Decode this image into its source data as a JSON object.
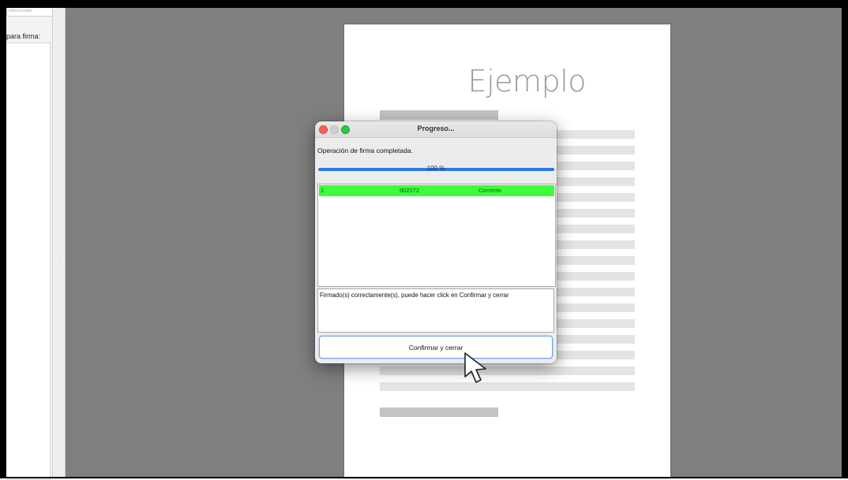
{
  "left_panel": {
    "search_placeholder": "seleccionado",
    "label": "para firma:"
  },
  "document": {
    "title": "Ejemplo"
  },
  "dialog": {
    "title": "Progreso...",
    "status": "Operación de firma completada.",
    "progress_text": "100 %",
    "progress_value": 1.0,
    "results": [
      {
        "index": "1",
        "id": "902272",
        "status": "Correcto"
      }
    ],
    "message": "Firmado(s) correctamente(s), puede hacer click en Confirmar y cerrar",
    "confirm_label": "Confirmar y cerrar"
  },
  "colors": {
    "success_row": "#3dfc3d",
    "progress": "#2b78e4",
    "close": "#fe5f57",
    "maximize": "#28c840"
  }
}
